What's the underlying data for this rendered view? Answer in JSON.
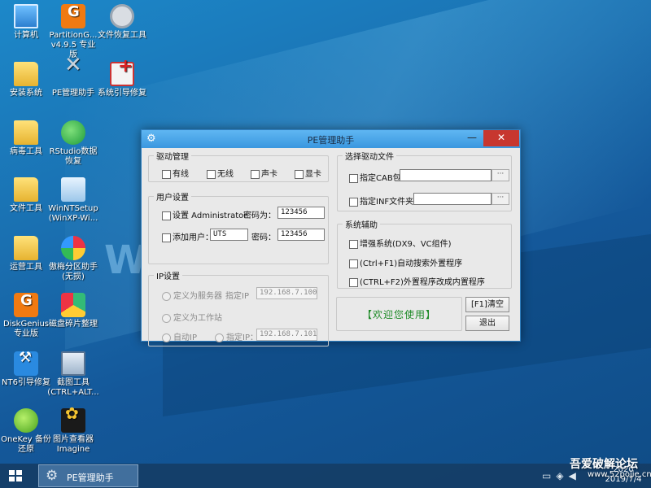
{
  "desktop": {
    "icons": [
      {
        "label": "计算机",
        "icon": "computer-icon"
      },
      {
        "label": "PartitionG... v4.9.5 专业版",
        "icon": "partition-icon"
      },
      {
        "label": "文件恢复工具",
        "icon": "file-recovery-icon"
      },
      {
        "label": "安装系统",
        "icon": "folder-icon"
      },
      {
        "label": "PE管理助手",
        "icon": "tools-icon"
      },
      {
        "label": "系统引导修复",
        "icon": "first-aid-kit-icon"
      },
      {
        "label": "病毒工具",
        "icon": "folder-icon"
      },
      {
        "label": "RStudio数据 恢复",
        "icon": "rstudio-icon"
      },
      {
        "label": "文件工具",
        "icon": "folder-icon"
      },
      {
        "label": "WinNTSetup (WinXP-Wi...",
        "icon": "winntsetup-icon"
      },
      {
        "label": "运营工具",
        "icon": "folder-icon"
      },
      {
        "label": "傲梅分区助手 (无损)",
        "icon": "aomei-icon"
      },
      {
        "label": "DiskGenius 专业版",
        "icon": "diskgenius-icon"
      },
      {
        "label": "磁盘碎片整理",
        "icon": "defrag-icon"
      },
      {
        "label": "NT6引导修复",
        "icon": "nt6-repair-icon"
      },
      {
        "label": "截图工具 (CTRL+ALT...",
        "icon": "snipping-tool-icon"
      },
      {
        "label": "OneKey 备份 还原",
        "icon": "onekey-icon"
      },
      {
        "label": "图片查看器 Imagine",
        "icon": "imagine-icon"
      }
    ],
    "wallpaper_text": "W         统"
  },
  "window": {
    "title": "PE管理助手",
    "minimize_glyph": "—",
    "close_glyph": "✕",
    "driver_mgmt": {
      "title": "驱动管理",
      "items": [
        "有线",
        "无线",
        "声卡",
        "显卡"
      ]
    },
    "user_settings": {
      "title": "用户设置",
      "set_admin_label": "设置 Administrator",
      "password_label_1": "密码为：",
      "password_value_1": "123456",
      "add_user_label": "添加用户：",
      "add_user_value": "UTS",
      "password_label_2": "密码：",
      "password_value_2": "123456"
    },
    "ip_settings": {
      "title": "IP设置",
      "server_label": "定义为服务器",
      "specify_ip_label_1": "指定IP",
      "ip_value_1": "192.168.7.100",
      "workstation_label": "定义为工作站",
      "auto_ip_label": "自动IP",
      "specify_ip_label_2": "指定IP：",
      "ip_value_2": "192.168.7.101"
    },
    "driver_file": {
      "title": "选择驱动文件",
      "cab_label": "指定CAB包：",
      "cab_value": "",
      "inf_label": "指定INF文件夹：",
      "inf_value": "",
      "browse_label": "···"
    },
    "sys_assist": {
      "title": "系统辅助",
      "items": [
        "增强系统(DX9、VC组件)",
        "(Ctrl+F1)自动搜索外置程序",
        "(CTRL+F2)外置程序改成内置程序"
      ]
    },
    "welcome_text": "【欢迎您使用】",
    "clear_button": "[F1]清空",
    "exit_button": "退出"
  },
  "taskbar": {
    "task_label": "PE管理助手",
    "clock_time": "2020",
    "clock_date": "2019/7/4"
  },
  "watermark": {
    "line1": "吾爱破解论坛",
    "line2": "www.52pojie.cn"
  }
}
